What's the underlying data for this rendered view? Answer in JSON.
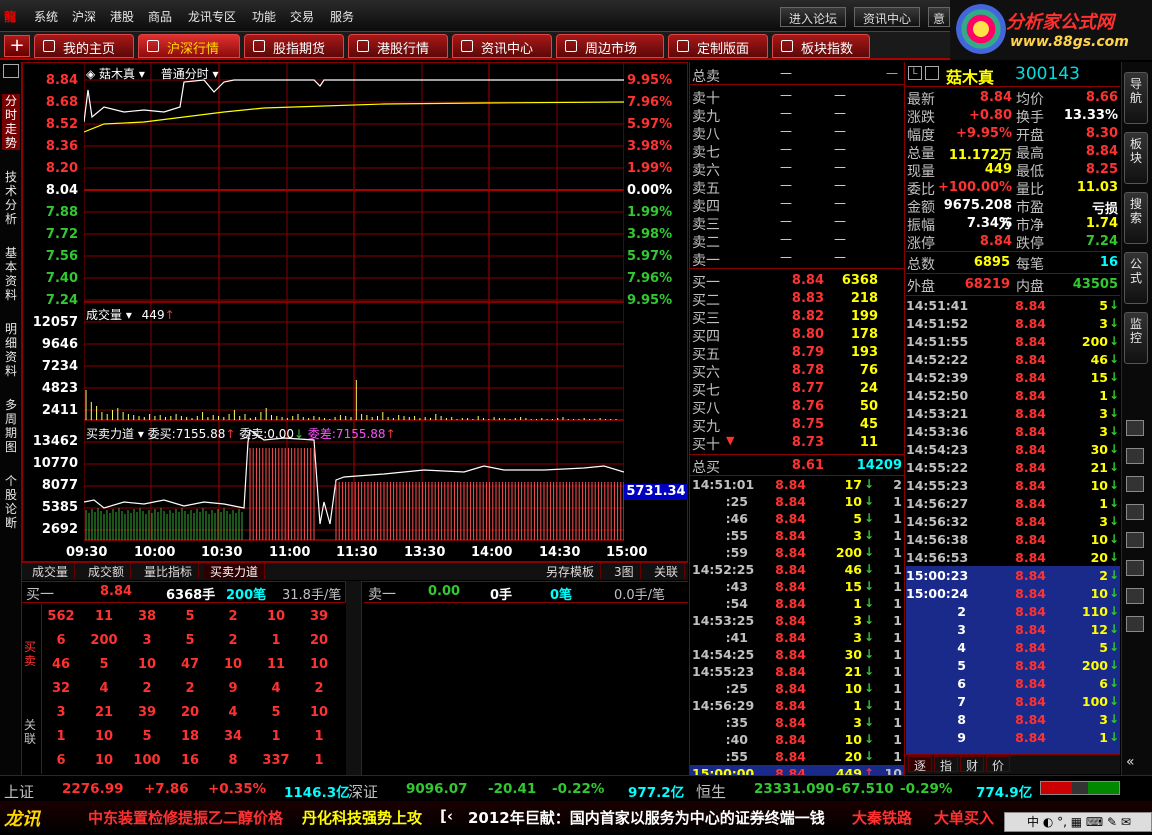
{
  "menu": {
    "items": [
      "系统",
      "沪深",
      "港股",
      "商品",
      "龙讯专区",
      "功能",
      "交易",
      "服务"
    ],
    "btn_forum": "进入论坛",
    "btn_info": "资讯中心",
    "btn_more": "意"
  },
  "brand": {
    "title": "分析家公式网",
    "url": "www.88gs.com"
  },
  "tabs": [
    "我的主页",
    "沪深行情",
    "股指期货",
    "港股行情",
    "资讯中心",
    "周边市场",
    "定制版面",
    "板块指数"
  ],
  "left_side": [
    "分时走势",
    "技术分析",
    "基本资料",
    "明细资料",
    "多周期图",
    "个股论断"
  ],
  "chart": {
    "stock_name": "菇木真",
    "mode": "普通分时",
    "y_left": [
      "8.84",
      "8.68",
      "8.52",
      "8.36",
      "8.20",
      "8.04",
      "7.88",
      "7.72",
      "7.56",
      "7.40",
      "7.24"
    ],
    "y_right": [
      "9.95%",
      "7.96%",
      "5.97%",
      "3.98%",
      "1.99%",
      "0.00%",
      "1.99%",
      "3.98%",
      "5.97%",
      "7.96%",
      "9.95%"
    ],
    "vol_label": "成交量",
    "vol_value": "449",
    "vol_y": [
      "12057",
      "9646",
      "7234",
      "4823",
      "2411"
    ],
    "force_label": "买卖力道",
    "force_buy": "委买:7155.88",
    "force_sell": "委卖:0.00",
    "force_diff": "委差:7155.88",
    "force_y": [
      "13462",
      "10770",
      "8077",
      "5385",
      "2692"
    ],
    "force_marker": "5731.34",
    "x_labels": [
      "09:30",
      "10:00",
      "10:30",
      "11:00",
      "11:30",
      "13:30",
      "14:00",
      "14:30",
      "15:00"
    ]
  },
  "bottom_tabs": [
    "成交量",
    "成交额",
    "量比指标",
    "买卖力道",
    "另存模板",
    "3图",
    "关联"
  ],
  "orderbook": {
    "buy_head": {
      "label": "买一",
      "price": "8.84",
      "hand": "6368手",
      "count": "200笔",
      "avg": "31.8手/笔"
    },
    "sell_head": {
      "label": "卖一",
      "price": "0.00",
      "hand": "0手",
      "count": "0笔",
      "avg": "0.0手/笔"
    },
    "side_labels": [
      "买卖",
      "关联"
    ],
    "rows": [
      [
        "562",
        "11",
        "38",
        "5",
        "2",
        "10",
        "39"
      ],
      [
        "6",
        "200",
        "3",
        "5",
        "2",
        "1",
        "20"
      ],
      [
        "46",
        "5",
        "10",
        "47",
        "10",
        "11",
        "10"
      ],
      [
        "32",
        "4",
        "2",
        "2",
        "9",
        "4",
        "2"
      ],
      [
        "3",
        "21",
        "39",
        "20",
        "4",
        "5",
        "10"
      ],
      [
        "1",
        "10",
        "5",
        "18",
        "34",
        "1",
        "1"
      ],
      [
        "6",
        "10",
        "100",
        "16",
        "8",
        "337",
        "1"
      ]
    ]
  },
  "quotes": {
    "total_sell": "总卖",
    "dash": "—",
    "sells": [
      "卖十",
      "卖九",
      "卖八",
      "卖七",
      "卖六",
      "卖五",
      "卖四",
      "卖三",
      "卖二",
      "卖一"
    ],
    "buys": [
      {
        "l": "买一",
        "p": "8.84",
        "v": "6368"
      },
      {
        "l": "买二",
        "p": "8.83",
        "v": "218"
      },
      {
        "l": "买三",
        "p": "8.82",
        "v": "199"
      },
      {
        "l": "买四",
        "p": "8.80",
        "v": "178"
      },
      {
        "l": "买五",
        "p": "8.79",
        "v": "193"
      },
      {
        "l": "买六",
        "p": "8.78",
        "v": "76"
      },
      {
        "l": "买七",
        "p": "8.77",
        "v": "24"
      },
      {
        "l": "买八",
        "p": "8.76",
        "v": "50"
      },
      {
        "l": "买九",
        "p": "8.75",
        "v": "45"
      },
      {
        "l": "买十",
        "p": "8.73",
        "v": "11"
      }
    ],
    "total_buy": {
      "l": "总买",
      "p": "8.61",
      "v": "14209"
    }
  },
  "ticks_mid": [
    {
      "t": "14:51:01",
      "p": "8.84",
      "v": "17",
      "d": "↓",
      "n": "2"
    },
    {
      "t": ":25",
      "p": "8.84",
      "v": "10",
      "d": "↓",
      "n": "1"
    },
    {
      "t": ":46",
      "p": "8.84",
      "v": "5",
      "d": "↓",
      "n": "1"
    },
    {
      "t": ":55",
      "p": "8.84",
      "v": "3",
      "d": "↓",
      "n": "1"
    },
    {
      "t": ":59",
      "p": "8.84",
      "v": "200",
      "d": "↓",
      "n": "1"
    },
    {
      "t": "14:52:25",
      "p": "8.84",
      "v": "46",
      "d": "↓",
      "n": "1"
    },
    {
      "t": ":43",
      "p": "8.84",
      "v": "15",
      "d": "↓",
      "n": "1"
    },
    {
      "t": ":54",
      "p": "8.84",
      "v": "1",
      "d": "↓",
      "n": "1"
    },
    {
      "t": "14:53:25",
      "p": "8.84",
      "v": "3",
      "d": "↓",
      "n": "1"
    },
    {
      "t": ":41",
      "p": "8.84",
      "v": "3",
      "d": "↓",
      "n": "1"
    },
    {
      "t": "14:54:25",
      "p": "8.84",
      "v": "30",
      "d": "↓",
      "n": "1"
    },
    {
      "t": "14:55:23",
      "p": "8.84",
      "v": "21",
      "d": "↓",
      "n": "1"
    },
    {
      "t": ":25",
      "p": "8.84",
      "v": "10",
      "d": "↓",
      "n": "1"
    },
    {
      "t": "14:56:29",
      "p": "8.84",
      "v": "1",
      "d": "↓",
      "n": "1"
    },
    {
      "t": ":35",
      "p": "8.84",
      "v": "3",
      "d": "↓",
      "n": "1"
    },
    {
      "t": ":40",
      "p": "8.84",
      "v": "10",
      "d": "↓",
      "n": "1"
    },
    {
      "t": ":55",
      "p": "8.84",
      "v": "20",
      "d": "↓",
      "n": "1"
    },
    {
      "t": "15:00:00",
      "p": "8.84",
      "v": "449",
      "d": "↑",
      "n": "10"
    }
  ],
  "stock": {
    "name": "菇木真",
    "code": "300143",
    "info": [
      {
        "a": "最新",
        "av": "8.84",
        "ac": "red",
        "b": "均价",
        "bv": "8.66",
        "bc": "red"
      },
      {
        "a": "涨跌",
        "av": "+0.80",
        "ac": "red",
        "b": "换手",
        "bv": "13.33%",
        "bc": "white"
      },
      {
        "a": "幅度",
        "av": "+9.95%",
        "ac": "red",
        "b": "开盘",
        "bv": "8.30",
        "bc": "red"
      },
      {
        "a": "总量",
        "av": "11.172万",
        "ac": "yellow",
        "b": "最高",
        "bv": "8.84",
        "bc": "red"
      },
      {
        "a": "现量",
        "av": "449",
        "ac": "yellow",
        "b": "最低",
        "bv": "8.25",
        "bc": "red"
      },
      {
        "a": "委比",
        "av": "+100.00%",
        "ac": "red",
        "b": "量比",
        "bv": "11.03",
        "bc": "yellow"
      },
      {
        "a": "金额",
        "av": "9675.208万",
        "ac": "white",
        "b": "市盈",
        "bv": "亏损",
        "bc": "white"
      },
      {
        "a": "振幅",
        "av": "7.34%",
        "ac": "white",
        "b": "市净",
        "bv": "1.74",
        "bc": "yellow"
      },
      {
        "a": "涨停",
        "av": "8.84",
        "ac": "red",
        "b": "跌停",
        "bv": "7.24",
        "bc": "green"
      }
    ],
    "total_count_l": "总数",
    "total_count": "6895",
    "per_l": "每笔",
    "per": "16",
    "outer_l": "外盘",
    "outer": "68219",
    "inner_l": "内盘",
    "inner": "43505"
  },
  "ticks_right": [
    {
      "t": "14:51:41",
      "p": "8.84",
      "v": "5",
      "d": "↓"
    },
    {
      "t": "14:51:52",
      "p": "8.84",
      "v": "3",
      "d": "↓"
    },
    {
      "t": "14:51:55",
      "p": "8.84",
      "v": "200",
      "d": "↓"
    },
    {
      "t": "14:52:22",
      "p": "8.84",
      "v": "46",
      "d": "↓"
    },
    {
      "t": "14:52:39",
      "p": "8.84",
      "v": "15",
      "d": "↓"
    },
    {
      "t": "14:52:50",
      "p": "8.84",
      "v": "1",
      "d": "↓"
    },
    {
      "t": "14:53:21",
      "p": "8.84",
      "v": "3",
      "d": "↓"
    },
    {
      "t": "14:53:36",
      "p": "8.84",
      "v": "3",
      "d": "↓"
    },
    {
      "t": "14:54:23",
      "p": "8.84",
      "v": "30",
      "d": "↓"
    },
    {
      "t": "14:55:22",
      "p": "8.84",
      "v": "21",
      "d": "↓"
    },
    {
      "t": "14:55:23",
      "p": "8.84",
      "v": "10",
      "d": "↓"
    },
    {
      "t": "14:56:27",
      "p": "8.84",
      "v": "1",
      "d": "↓"
    },
    {
      "t": "14:56:32",
      "p": "8.84",
      "v": "3",
      "d": "↓"
    },
    {
      "t": "14:56:38",
      "p": "8.84",
      "v": "10",
      "d": "↓"
    },
    {
      "t": "14:56:53",
      "p": "8.84",
      "v": "20",
      "d": "↓"
    },
    {
      "t": "15:00:23",
      "p": "8.84",
      "v": "2",
      "d": "↓"
    },
    {
      "t": "15:00:24",
      "p": "8.84",
      "v": "10",
      "d": "↓"
    },
    {
      "t": "2",
      "p": "8.84",
      "v": "110",
      "d": "↓"
    },
    {
      "t": "3",
      "p": "8.84",
      "v": "12",
      "d": "↓"
    },
    {
      "t": "4",
      "p": "8.84",
      "v": "5",
      "d": "↓"
    },
    {
      "t": "5",
      "p": "8.84",
      "v": "200",
      "d": "↓"
    },
    {
      "t": "6",
      "p": "8.84",
      "v": "6",
      "d": "↓"
    },
    {
      "t": "7",
      "p": "8.84",
      "v": "100",
      "d": "↓"
    },
    {
      "t": "8",
      "p": "8.84",
      "v": "3",
      "d": "↓"
    },
    {
      "t": "9",
      "p": "8.84",
      "v": "1",
      "d": "↓"
    }
  ],
  "right_tabs": [
    "逐",
    "指",
    "财",
    "价"
  ],
  "right_side": [
    "导航",
    "板块",
    "搜索",
    "公式",
    "监控"
  ],
  "status": [
    {
      "n": "上证",
      "v": "2276.99",
      "c": "+7.86",
      "p": "+0.35%",
      "a": "1146.3亿"
    },
    {
      "n": "深证",
      "v": "9096.07",
      "c": "-20.41",
      "p": "-0.22%",
      "a": "977.2亿"
    },
    {
      "n": "恒生",
      "v": "23331.090",
      "c": "-67.510",
      "p": "-0.29%",
      "a": "774.9亿"
    }
  ],
  "ticker": {
    "logo": "龙讯",
    "text1": "中东装置检修提振乙二醇价格",
    "text2": "丹化科技强势上攻",
    "text3": "2012年巨献：国内首家以服务为中心的证券终端一钱",
    "text4": "大秦铁路",
    "text5": "大单买入",
    "tray": "中"
  }
}
